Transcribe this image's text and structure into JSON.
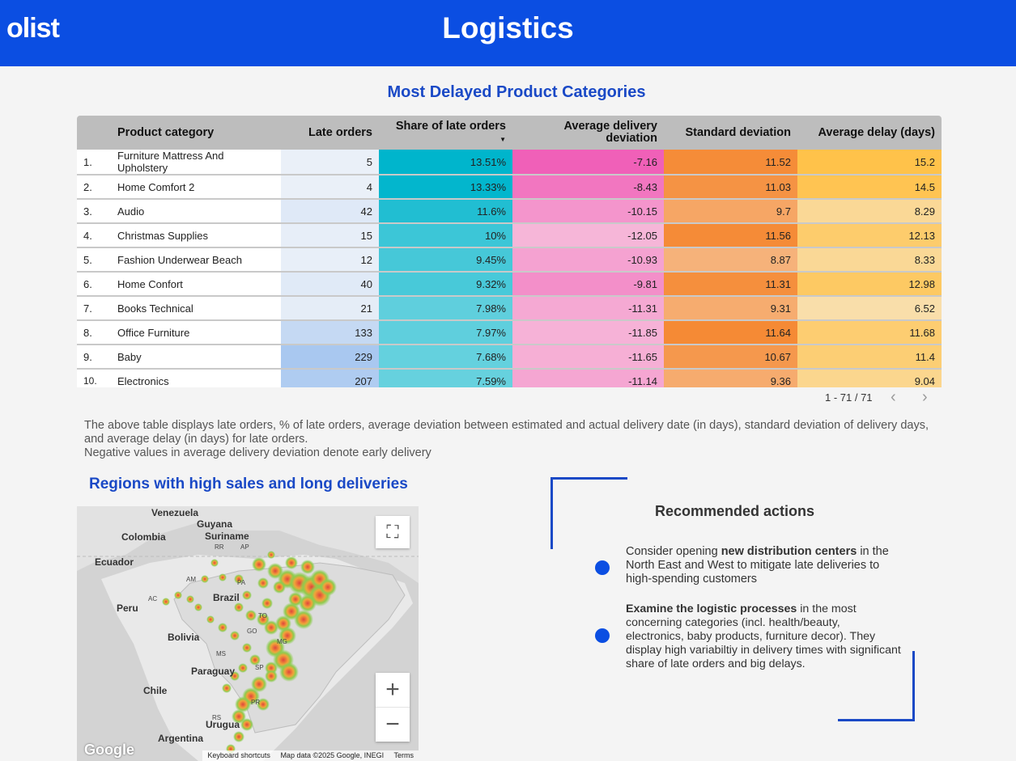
{
  "header": {
    "logo": "olist",
    "title": "Logistics"
  },
  "table_section": {
    "title": "Most Delayed Product Categories",
    "columns": [
      "Product category",
      "Late orders",
      "Share of late orders",
      "Average delivery deviation",
      "Standard deviation",
      "Average delay (days)"
    ],
    "sort_indicator": "▼",
    "rows": [
      {
        "rank": "1.",
        "category": "Furniture Mattress And Upholstery",
        "late": "5",
        "share": "13.51%",
        "dev": "-7.16",
        "std": "11.52",
        "delay": "15.2"
      },
      {
        "rank": "2.",
        "category": "Home Comfort 2",
        "late": "4",
        "share": "13.33%",
        "dev": "-8.43",
        "std": "11.03",
        "delay": "14.5"
      },
      {
        "rank": "3.",
        "category": "Audio",
        "late": "42",
        "share": "11.6%",
        "dev": "-10.15",
        "std": "9.7",
        "delay": "8.29"
      },
      {
        "rank": "4.",
        "category": "Christmas Supplies",
        "late": "15",
        "share": "10%",
        "dev": "-12.05",
        "std": "11.56",
        "delay": "12.13"
      },
      {
        "rank": "5.",
        "category": "Fashion Underwear Beach",
        "late": "12",
        "share": "9.45%",
        "dev": "-10.93",
        "std": "8.87",
        "delay": "8.33"
      },
      {
        "rank": "6.",
        "category": "Home Confort",
        "late": "40",
        "share": "9.32%",
        "dev": "-9.81",
        "std": "11.31",
        "delay": "12.98"
      },
      {
        "rank": "7.",
        "category": "Books Technical",
        "late": "21",
        "share": "7.98%",
        "dev": "-11.31",
        "std": "9.31",
        "delay": "6.52"
      },
      {
        "rank": "8.",
        "category": "Office Furniture",
        "late": "133",
        "share": "7.97%",
        "dev": "-11.85",
        "std": "11.64",
        "delay": "11.68"
      },
      {
        "rank": "9.",
        "category": "Baby",
        "late": "229",
        "share": "7.68%",
        "dev": "-11.65",
        "std": "10.67",
        "delay": "11.4"
      },
      {
        "rank": "10.",
        "category": "Electronics",
        "late": "207",
        "share": "7.59%",
        "dev": "-11.14",
        "std": "9.36",
        "delay": "9.04"
      }
    ],
    "pagination": "1 - 71 / 71",
    "prev_label": "‹",
    "next_label": "›"
  },
  "description": {
    "line1": "The above table displays late orders, % of late orders, average deviation between estimated and actual delivery date (in days), standard deviation of delivery days, and average delay (in days) for late orders.",
    "line2": "Negative values in average delivery deviation denote early delivery"
  },
  "map_section": {
    "title": "Regions with high sales and long deliveries",
    "labels": {
      "venezuela": "Venezuela",
      "guyana": "Guyana",
      "suriname": "Suriname",
      "colombia": "Colombia",
      "ecuador": "Ecuador",
      "peru": "Peru",
      "brazil": "Brazil",
      "bolivia": "Bolivia",
      "paraguay": "Paraguay",
      "chile": "Chile",
      "uruguay": "Urugua",
      "argentina": "Argentina"
    },
    "state_labels": [
      "RR",
      "AP",
      "AM",
      "PA",
      "AC",
      "MG",
      "SP",
      "PR",
      "RS",
      "TO",
      "GO",
      "MS"
    ],
    "fullscreen_icon": "⛶",
    "zoom_in": "+",
    "zoom_out": "−",
    "google": "Google",
    "keyboard_shortcuts": "Keyboard shortcuts",
    "map_data": "Map data ©2025 Google, INEGI",
    "terms": "Terms"
  },
  "actions": {
    "title": "Recommended actions",
    "item1_pre": "Consider opening ",
    "item1_bold": "new distribution centers",
    "item1_post": " in the North East and West to mitigate late deliveries to high-spending customers",
    "item2_bold": "Examine the logistic processes",
    "item2_post": " in the most concerning categories (incl. health/beauty, electronics, baby products, furniture decor). They display high variabiltiy in delivery times with significant share of late orders and big delays."
  },
  "colors": {
    "header": "#0b4ee2",
    "late_orders_scale": [
      "#eaf0f8",
      "#a9c8f0"
    ],
    "share_scale": [
      "#00b5cc",
      "#66d1de"
    ],
    "deviation_scale": [
      "#f060b8",
      "#f6b6d8"
    ],
    "std_scale": [
      "#f58a35",
      "#f6b27a"
    ],
    "delay_scale": [
      "#ffc24a",
      "#f9deaa"
    ]
  }
}
